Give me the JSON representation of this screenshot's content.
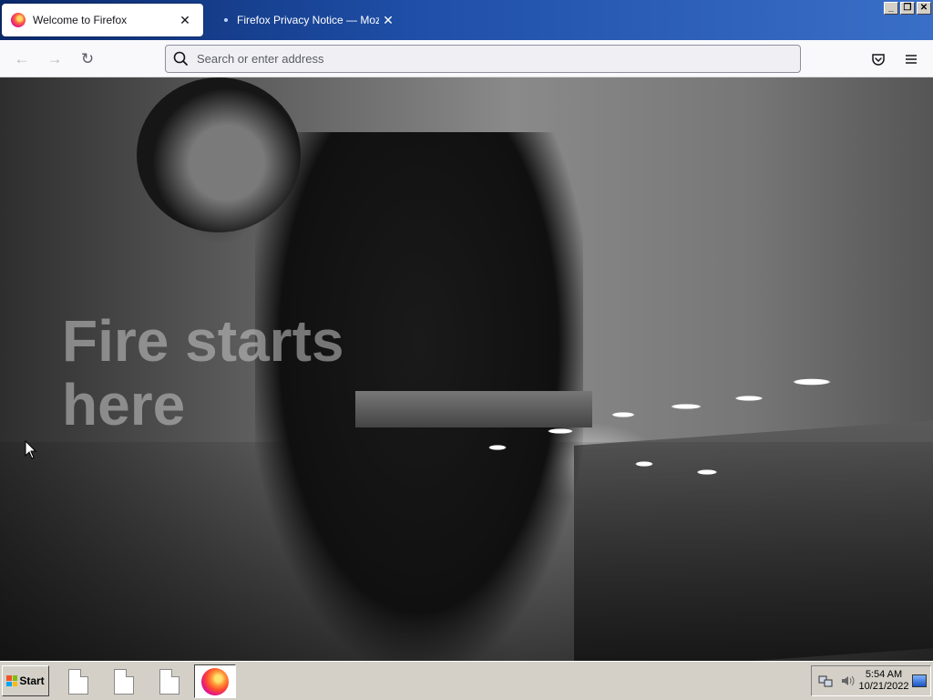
{
  "browser": {
    "tabs": [
      {
        "label": "Welcome to Firefox",
        "close": "✕"
      },
      {
        "label": "Firefox Privacy Notice — Mozilla",
        "close": "✕"
      }
    ],
    "window_controls": {
      "minimize": "_",
      "restore": "❐",
      "close": "✕"
    }
  },
  "navbar": {
    "back_icon": "←",
    "forward_icon": "→",
    "reload_icon": "↻",
    "url_placeholder": "Search or enter address",
    "url_value": "",
    "pocket_icon": "⛉",
    "menu_icon": "≡"
  },
  "content": {
    "hero_title_line1": "Fire starts",
    "hero_title_line2": "here"
  },
  "taskbar": {
    "start_label": "Start",
    "clock_time": "5:54 AM",
    "clock_date": "10/21/2022"
  },
  "colors": {
    "tab_strip_dark": "#0b2a6b",
    "tab_strip_light": "#3a6fc8",
    "taskbar": "#d4d0c8"
  }
}
